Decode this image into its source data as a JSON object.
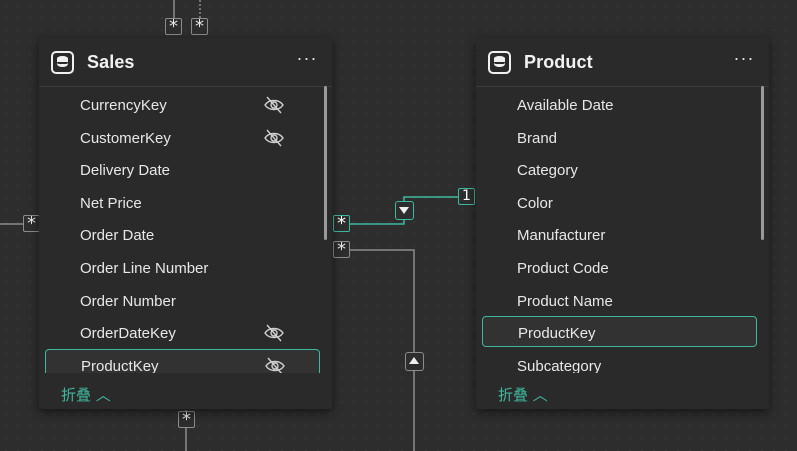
{
  "colors": {
    "accent": "#3fb8a0",
    "background": "#2d2d2d",
    "card": "#2a2a2a",
    "text": "#e8e8e8"
  },
  "relationships": {
    "many_symbol": "*",
    "one_symbol": "1",
    "filter_direction_down": "triangle-down-icon",
    "filter_direction_up": "triangle-up-icon"
  },
  "sales_table": {
    "title": "Sales",
    "icon": "table-icon",
    "more_label": "···",
    "collapse_label": "折叠 ︿",
    "fields": [
      {
        "label": "CurrencyKey",
        "hidden": true
      },
      {
        "label": "CustomerKey",
        "hidden": true
      },
      {
        "label": "Delivery Date",
        "hidden": false
      },
      {
        "label": "Net Price",
        "hidden": false
      },
      {
        "label": "Order Date",
        "hidden": false
      },
      {
        "label": "Order Line Number",
        "hidden": false
      },
      {
        "label": "Order Number",
        "hidden": false
      },
      {
        "label": "OrderDateKey",
        "hidden": true
      },
      {
        "label": "ProductKey",
        "hidden": true,
        "selected": true
      }
    ]
  },
  "product_table": {
    "title": "Product",
    "icon": "table-icon",
    "more_label": "···",
    "collapse_label": "折叠 ︿",
    "fields": [
      {
        "label": "Available Date",
        "hidden": false
      },
      {
        "label": "Brand",
        "hidden": false
      },
      {
        "label": "Category",
        "hidden": false
      },
      {
        "label": "Color",
        "hidden": false
      },
      {
        "label": "Manufacturer",
        "hidden": false
      },
      {
        "label": "Product Code",
        "hidden": false
      },
      {
        "label": "Product Name",
        "hidden": false
      },
      {
        "label": "ProductKey",
        "hidden": false,
        "selected": true
      },
      {
        "label": "Subcategory",
        "hidden": false
      }
    ]
  }
}
